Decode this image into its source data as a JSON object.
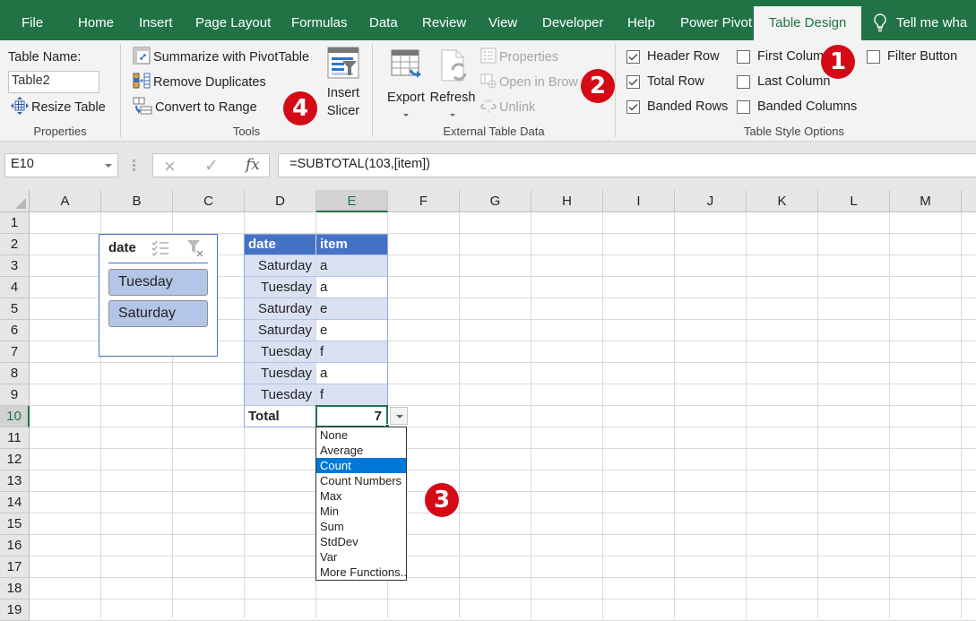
{
  "tabs": [
    {
      "label": "File",
      "active": false
    },
    {
      "label": "Home",
      "active": false
    },
    {
      "label": "Insert",
      "active": false
    },
    {
      "label": "Page Layout",
      "active": false
    },
    {
      "label": "Formulas",
      "active": false
    },
    {
      "label": "Data",
      "active": false
    },
    {
      "label": "Review",
      "active": false
    },
    {
      "label": "View",
      "active": false
    },
    {
      "label": "Developer",
      "active": false
    },
    {
      "label": "Help",
      "active": false
    },
    {
      "label": "Power Pivot",
      "active": false
    },
    {
      "label": "Table Design",
      "active": true
    }
  ],
  "tell_me": "Tell me wha",
  "ribbon": {
    "properties": {
      "table_name_label": "Table Name:",
      "table_name_value": "Table2",
      "resize_table": "Resize Table",
      "group_label": "Properties"
    },
    "tools": {
      "summarize_pivot": "Summarize with PivotTable",
      "remove_duplicates": "Remove Duplicates",
      "convert_to_range": "Convert to Range",
      "insert_slicer_line1": "Insert",
      "insert_slicer_line2": "Slicer",
      "group_label": "Tools"
    },
    "external": {
      "export": "Export",
      "refresh": "Refresh",
      "properties": "Properties",
      "open_in_browser": "Open in Brow",
      "unlink": "Unlink",
      "group_label": "External Table Data"
    },
    "style_options": {
      "header_row": {
        "label": "Header Row",
        "checked": true
      },
      "total_row": {
        "label": "Total Row",
        "checked": true
      },
      "banded_rows": {
        "label": "Banded Rows",
        "checked": true
      },
      "first_column": {
        "label": "First Colum",
        "checked": false
      },
      "last_column": {
        "label": "Last Column",
        "checked": false
      },
      "banded_columns": {
        "label": "Banded Columns",
        "checked": false
      },
      "filter_button": {
        "label": "Filter Button",
        "checked": false
      },
      "group_label": "Table Style Options"
    }
  },
  "badges": [
    "1",
    "2",
    "3",
    "4"
  ],
  "formula_bar": {
    "name_box": "E10",
    "cancel_icon": "×",
    "enter_icon": "✓",
    "fx_label": "fx",
    "formula": "=SUBTOTAL(103,[item])"
  },
  "sheet": {
    "columns": [
      "A",
      "B",
      "C",
      "D",
      "E",
      "F",
      "G",
      "H",
      "I",
      "J",
      "K",
      "L",
      "M"
    ],
    "selected_column": "E",
    "rows": [
      "1",
      "2",
      "3",
      "4",
      "5",
      "6",
      "7",
      "8",
      "9",
      "10",
      "11",
      "12",
      "13",
      "14",
      "15",
      "16",
      "17",
      "18",
      "19"
    ],
    "selected_row": "10"
  },
  "table": {
    "headers": [
      "date",
      "item"
    ],
    "rows": [
      [
        "Saturday",
        "a"
      ],
      [
        "Tuesday",
        "a"
      ],
      [
        "Saturday",
        "e"
      ],
      [
        "Saturday",
        "e"
      ],
      [
        "Tuesday",
        "f"
      ],
      [
        "Tuesday",
        "a"
      ],
      [
        "Tuesday",
        "f"
      ]
    ],
    "total_label": "Total",
    "total_value": "7",
    "header_color": "#4472c4",
    "band_color": "#d9e1f2"
  },
  "total_dropdown": {
    "options": [
      "None",
      "Average",
      "Count",
      "Count Numbers",
      "Max",
      "Min",
      "Sum",
      "StdDev",
      "Var",
      "More Functions.."
    ],
    "selected": "Count"
  },
  "slicer": {
    "title": "date",
    "items": [
      "Tuesday",
      "Saturday"
    ]
  },
  "colors": {
    "excel_green": "#217346",
    "badge_red": "#d40a16",
    "selection_blue": "#0078d7"
  }
}
